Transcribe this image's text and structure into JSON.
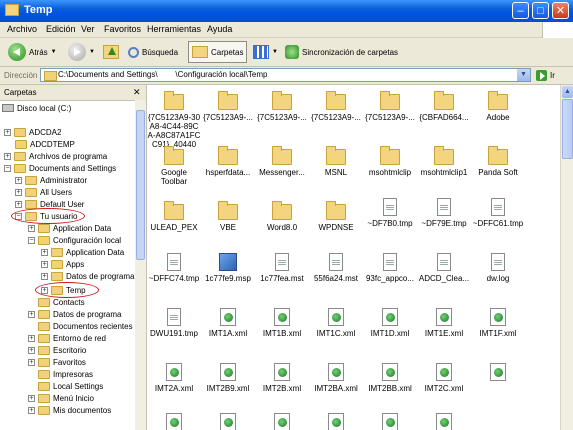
{
  "window": {
    "title": "Temp"
  },
  "menu": [
    "Archivo",
    "Edición",
    "Ver",
    "Favoritos",
    "Herramientas",
    "Ayuda"
  ],
  "toolbar": {
    "back": "Atrás",
    "search": "Búsqueda",
    "folders": "Carpetas",
    "sync": "Sincronización de carpetas"
  },
  "address": {
    "label": "Dirección",
    "path": "C:\\Documents and Settings\\        \\Configuración local\\Temp",
    "go": "Ir"
  },
  "tree": {
    "title": "Carpetas",
    "items": [
      "Disco local (C:)",
      "ADCDA2",
      "ADCDTEMP",
      "Archivos de programa",
      "Documents and Settings",
      "Administrator",
      "All Users",
      "Default User",
      "Tu usuario",
      "Application Data",
      "Configuración local",
      "Application Data",
      "Apps",
      "Datos de programa",
      "Temp",
      "Contacts",
      "Datos de programa",
      "Documentos recientes",
      "Entorno de red",
      "Escritorio",
      "Favoritos",
      "Impresoras",
      "Local Settings",
      "Menú Inicio",
      "Mis documentos"
    ]
  },
  "files": [
    {
      "name": "{7C5123A9-30 A8-4C44-89C A-A8C87A1FC C91}_40440",
      "icon": "folder"
    },
    {
      "name": "{7C5123A9-...",
      "icon": "folder"
    },
    {
      "name": "{7C5123A9-...",
      "icon": "folder"
    },
    {
      "name": "{7C5123A9-...",
      "icon": "folder"
    },
    {
      "name": "{7C5123A9-...",
      "icon": "folder"
    },
    {
      "name": "{CBFAD664...",
      "icon": "folder"
    },
    {
      "name": "Adobe",
      "icon": "folder"
    },
    {
      "name": "Google Toolbar",
      "icon": "folder"
    },
    {
      "name": "hsperfdata...",
      "icon": "folder"
    },
    {
      "name": "Messenger...",
      "icon": "folder"
    },
    {
      "name": "MSNL",
      "icon": "folder"
    },
    {
      "name": "msohtmlclip",
      "icon": "folder"
    },
    {
      "name": "msohtmlclip1",
      "icon": "folder"
    },
    {
      "name": "Panda Soft",
      "icon": "folder"
    },
    {
      "name": "ULEAD_PEX",
      "icon": "folder"
    },
    {
      "name": "VBE",
      "icon": "folder"
    },
    {
      "name": "Word8.0",
      "icon": "folder"
    },
    {
      "name": "WPDNSE",
      "icon": "folder"
    },
    {
      "name": "~DF7B0.tmp",
      "icon": "file"
    },
    {
      "name": "~DF79E.tmp",
      "icon": "file"
    },
    {
      "name": "~DFFC61.tmp",
      "icon": "file"
    },
    {
      "name": "~DFFC74.tmp",
      "icon": "file"
    },
    {
      "name": "1c77fe9.msp",
      "icon": "msp"
    },
    {
      "name": "1c77fea.mst",
      "icon": "file"
    },
    {
      "name": "55f6a24.mst",
      "icon": "file"
    },
    {
      "name": "93fc_appco...",
      "icon": "file"
    },
    {
      "name": "ADCD_Clea...",
      "icon": "file"
    },
    {
      "name": "dw.log",
      "icon": "file"
    },
    {
      "name": "DWU191.tmp",
      "icon": "file"
    },
    {
      "name": "IMT1A.xml",
      "icon": "xml"
    },
    {
      "name": "IMT1B.xml",
      "icon": "xml"
    },
    {
      "name": "IMT1C.xml",
      "icon": "xml"
    },
    {
      "name": "IMT1D.xml",
      "icon": "xml"
    },
    {
      "name": "IMT1E.xml",
      "icon": "xml"
    },
    {
      "name": "IMT1F.xml",
      "icon": "xml"
    },
    {
      "name": "IMT2A.xml",
      "icon": "xml"
    },
    {
      "name": "IMT2B9.xml",
      "icon": "xml"
    },
    {
      "name": "IMT2B.xml",
      "icon": "xml"
    },
    {
      "name": "IMT2BA.xml",
      "icon": "xml"
    },
    {
      "name": "IMT2BB.xml",
      "icon": "xml"
    },
    {
      "name": "IMT2C.xml",
      "icon": "xml"
    },
    {
      "name": "",
      "icon": "xml"
    },
    {
      "name": "",
      "icon": "xml"
    },
    {
      "name": "",
      "icon": "xml"
    },
    {
      "name": "",
      "icon": "xml"
    },
    {
      "name": "",
      "icon": "xml"
    },
    {
      "name": "",
      "icon": "xml"
    },
    {
      "name": "",
      "icon": "xml"
    }
  ]
}
